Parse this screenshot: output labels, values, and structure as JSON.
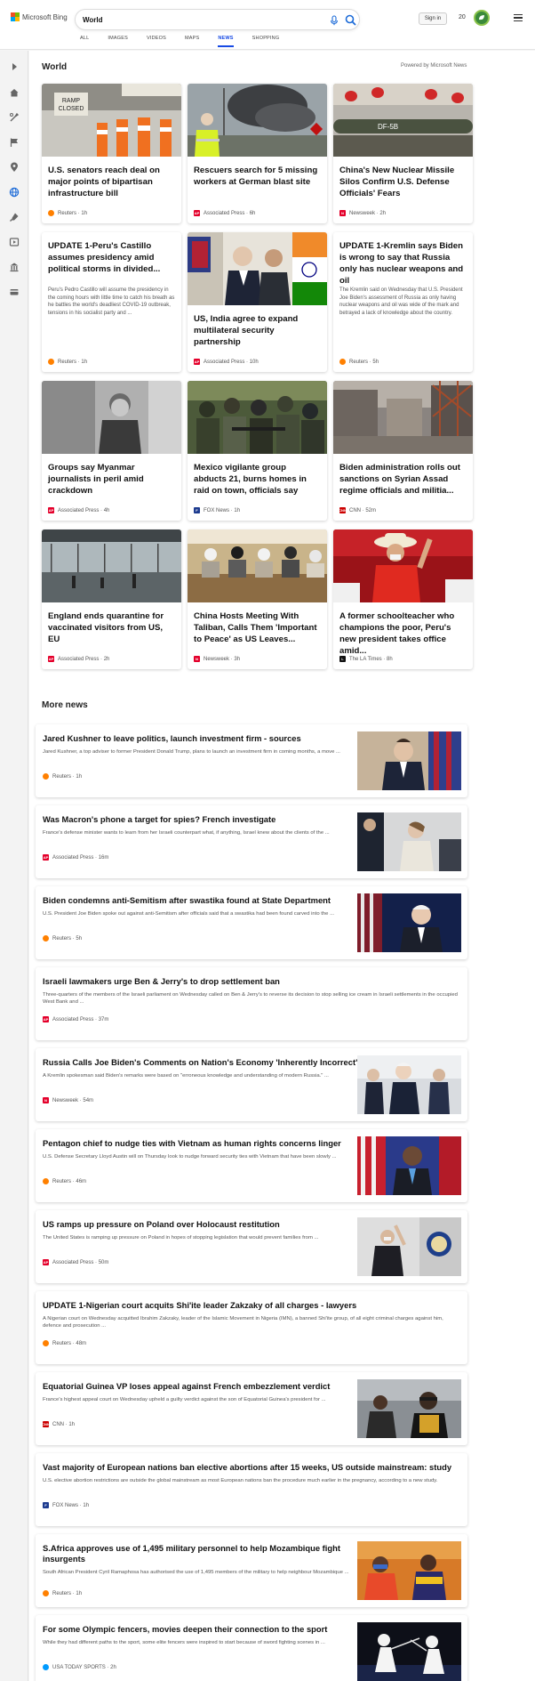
{
  "brand": {
    "name": "Microsoft Bing"
  },
  "search": {
    "query": "World"
  },
  "header": {
    "signin_label": "Sign in",
    "points": "20"
  },
  "scopes": [
    "ALL",
    "IMAGES",
    "VIDEOS",
    "MAPS",
    "NEWS",
    "SHOPPING"
  ],
  "section": {
    "title": "World",
    "powered_by": "Powered by Microsoft News"
  },
  "cards": [
    {
      "title": "U.S. senators reach deal on major points of bipartisan infrastructure bill",
      "desc": "",
      "source": "Reuters",
      "time": "1h"
    },
    {
      "title": "Rescuers search for 5 missing workers at German blast site",
      "desc": "",
      "source": "Associated Press",
      "time": "6h"
    },
    {
      "title": "China's New Nuclear Missile Silos Confirm U.S. Defense Officials' Fears",
      "desc": "",
      "source": "Newsweek",
      "time": "2h"
    },
    {
      "title": "UPDATE 1-Peru's Castillo assumes presidency amid political storms in divided...",
      "desc": "Peru's Pedro Castillo will assume the presidency in the coming hours with little time to catch his breath as he battles the world's deadliest COVID-19 outbreak, tensions in his socialist party and ...",
      "source": "Reuters",
      "time": "1h"
    },
    {
      "title": "US, India agree to expand multilateral security partnership",
      "desc": "",
      "source": "Associated Press",
      "time": "10h"
    },
    {
      "title": "UPDATE 1-Kremlin says Biden is wrong to say that Russia only has nuclear weapons and oil",
      "desc": "The Kremlin said on Wednesday that U.S. President Joe Biden's assessment of Russia as only having nuclear weapons and oil was wide of the mark and betrayed a lack of knowledge about the country.",
      "source": "Reuters",
      "time": "5h"
    },
    {
      "title": "Groups say Myanmar journalists in peril amid crackdown",
      "desc": "",
      "source": "Associated Press",
      "time": "4h"
    },
    {
      "title": "Mexico vigilante group abducts 21, burns homes in raid on town, officials say",
      "desc": "",
      "source": "FOX News",
      "time": "1h"
    },
    {
      "title": "Biden administration rolls out sanctions on Syrian Assad regime officials and militia...",
      "desc": "",
      "source": "CNN",
      "time": "52m"
    },
    {
      "title": "England ends quarantine for vaccinated visitors from US, EU",
      "desc": "",
      "source": "Associated Press",
      "time": "2h"
    },
    {
      "title": "China Hosts Meeting With Taliban, Calls Them 'Important to Peace' as US Leaves...",
      "desc": "",
      "source": "Newsweek",
      "time": "3h"
    },
    {
      "title": "A former schoolteacher who champions the poor, Peru's new president takes office amid...",
      "desc": "",
      "source": "The LA Times",
      "time": "8h"
    }
  ],
  "more_news": {
    "title": "More news",
    "items": [
      {
        "title": "Jared Kushner to leave politics, launch investment firm - sources",
        "desc": "Jared Kushner, a top adviser to former President Donald Trump, plans to launch an investment firm in coming months, a move ...",
        "source": "Reuters",
        "time": "1h"
      },
      {
        "title": "Was Macron's phone a target for spies? French investigate",
        "desc": "France's defense minister wants to learn from her Israeli counterpart what, if anything, Israel knew about the clients of the ...",
        "source": "Associated Press",
        "time": "16m"
      },
      {
        "title": "Biden condemns anti-Semitism after swastika found at State Department",
        "desc": "U.S. President Joe Biden spoke out against anti-Semitism after officials said that a swastika had been found carved into the ...",
        "source": "Reuters",
        "time": "5h"
      },
      {
        "title": "Israeli lawmakers urge Ben & Jerry's to drop settlement ban",
        "desc": "Three-quarters of the members of the Israeli parliament on Wednesday called on Ben & Jerry's to reverse its decision to stop selling ice cream in Israeli settlements in the occupied West Bank and ...",
        "source": "Associated Press",
        "time": "37m"
      },
      {
        "title": "Russia Calls Joe Biden's Comments on Nation's Economy 'Inherently Incorrect'",
        "desc": "A Kremlin spokesman said Biden's remarks were based on \"erroneous knowledge and understanding of modern Russia.\" ...",
        "source": "Newsweek",
        "time": "54m"
      },
      {
        "title": "Pentagon chief to nudge ties with Vietnam as human rights concerns linger",
        "desc": "U.S. Defense Secretary Lloyd Austin will on Thursday look to nudge forward security ties with Vietnam that have been slowly ...",
        "source": "Reuters",
        "time": "46m"
      },
      {
        "title": "US ramps up pressure on Poland over Holocaust restitution",
        "desc": "The United States is ramping up pressure on Poland in hopes of stopping legislation that would prevent families from ...",
        "source": "Associated Press",
        "time": "50m"
      },
      {
        "title": "UPDATE 1-Nigerian court acquits Shi'ite leader Zakzaky of all charges - lawyers",
        "desc": "A Nigerian court on Wednesday acquitted Ibrahim Zakzaky, leader of the Islamic Movement in Nigeria (IMN), a banned Shi'ite group, of all eight criminal charges against him, defence and prosecution ...",
        "source": "Reuters",
        "time": "48m"
      },
      {
        "title": "Equatorial Guinea VP loses appeal against French embezzlement verdict",
        "desc": "France's highest appeal court on Wednesday upheld a guilty verdict against the son of Equatorial Guinea's president for ...",
        "source": "CNN",
        "time": "1h"
      },
      {
        "title": "Vast majority of European nations ban elective abortions after 15 weeks, US outside mainstream: study",
        "desc": "U.S. elective abortion restrictions are outside the global mainstream as most European nations ban the procedure much earlier in the pregnancy, according to a new study.",
        "source": "FOX News",
        "time": "1h"
      },
      {
        "title": "S.Africa approves use of 1,495 military personnel to help Mozambique fight insurgents",
        "desc": "South African President Cyril Ramaphosa has authorised the use of 1,495 members of the military to help neighbour Mozambique ...",
        "source": "Reuters",
        "time": "1h"
      },
      {
        "title": "For some Olympic fencers, movies deepen their connection to the sport",
        "desc": "While they had different paths to the sport, some elite fencers were inspired to start because of sword fighting scenes in ...",
        "source": "USA TODAY SPORTS",
        "time": "2h"
      }
    ]
  },
  "colors": {
    "accent": "#174ae4",
    "reuters": "#ff8000",
    "ap": "#e4002b",
    "newsweek": "#e4002b",
    "cnn": "#cc0000",
    "fox": "#1d3b8f",
    "usatoday": "#009bff",
    "latimes": "#111111"
  }
}
